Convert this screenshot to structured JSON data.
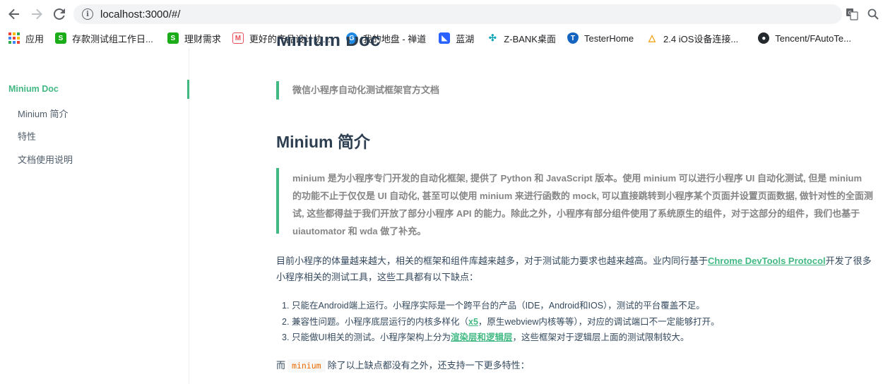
{
  "browser": {
    "url": "localhost:3000/#/",
    "bookmarks": [
      {
        "label": "应用",
        "icon": "apps-grid-icon",
        "color": "#4285f4"
      },
      {
        "label": "存款测试组工作日...",
        "icon": "s-icon",
        "color": "#1aad19"
      },
      {
        "label": "理财需求",
        "icon": "s-icon",
        "color": "#1aad19"
      },
      {
        "label": "更好的产品设计协...",
        "icon": "m-icon",
        "color": "#e8505b"
      },
      {
        "label": "我的地盘 - 禅道",
        "icon": "zentao-icon",
        "color": "#1e88e5"
      },
      {
        "label": "蓝湖",
        "icon": "lanhu-icon",
        "color": "#2962ff"
      },
      {
        "label": "Z-BANK桌面",
        "icon": "zbank-icon",
        "color": "#0aa5b8"
      },
      {
        "label": "TesterHome",
        "icon": "testerhome-icon",
        "color": "#1565c0"
      },
      {
        "label": "2.4 iOS设备连接...",
        "icon": "triangle-icon",
        "color": "#f59e0b"
      },
      {
        "label": "Tencent/FAutoTe...",
        "icon": "github-icon",
        "color": "#24292e"
      }
    ]
  },
  "sidebar": {
    "title": "Minium Doc",
    "items": [
      {
        "label": "Minium 简介"
      },
      {
        "label": "特性"
      },
      {
        "label": "文档使用说明"
      }
    ]
  },
  "content": {
    "page_title": "Minium Doc",
    "subtitle_quote": "微信小程序自动化测试框架官方文档",
    "section_title": "Minium 简介",
    "intro_quote": "minium 是为小程序专门开发的自动化框架, 提供了 Python 和 JavaScript 版本。使用 minium 可以进行小程序 UI 自动化测试, 但是 minium 的功能不止于仅仅是 UI 自动化, 甚至可以使用 minium 来进行函数的 mock, 可以直接跳转到小程序某个页面并设置页面数据, 做针对性的全面测试, 这些都得益于我们开放了部分小程序 API 的能力。除此之外，小程序有部分组件使用了系统原生的组件，对于这部分的组件，我们也基于 uiautomator 和 wda 做了补充。",
    "para1_before": "目前小程序的体量越来越大，相关的框架和组件库越来越多，对于测试能力要求也越来越高。业内同行基于",
    "para1_link": "Chrome DevTools Protocol",
    "para1_after": "开发了很多小程序相关的测试工具，这些工具都有以下缺点：",
    "list": [
      {
        "num": "1.",
        "before": "只能在Android端上运行。小程序实际是一个跨平台的产品（IDE，Android和IOS），测试的平台覆盖不足。",
        "link": "",
        "after": ""
      },
      {
        "num": "2.",
        "before": "兼容性问题。小程序底层运行的内核多样化（",
        "link": "x5",
        "after": "，原生webview内核等等），对应的调试端口不一定能够打开。"
      },
      {
        "num": "3.",
        "before": "只能做UI相关的测试。小程序架构上分为",
        "link": "渲染层和逻辑层",
        "after": "，这些框架对于逻辑层上面的测试限制较大。"
      }
    ],
    "para2_before": "而",
    "para2_code": "minium",
    "para2_after": "除了以上缺点都没有之外，还支持一下更多特性："
  }
}
